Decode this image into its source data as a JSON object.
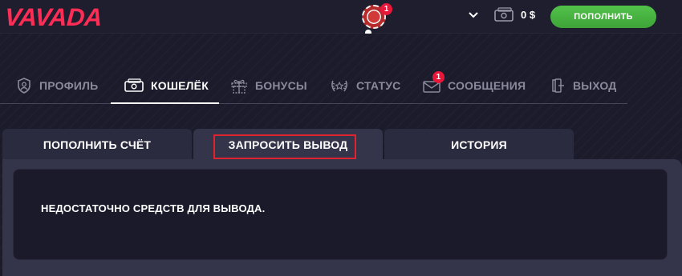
{
  "header": {
    "logo": "VAVADA",
    "avatar_badge": "1",
    "balance": "0 $",
    "deposit_label": "ПОПОЛНИТЬ",
    "icons": [
      "user-avatar-icon",
      "chevron-down-icon",
      "wallet-icon"
    ],
    "accent_color": "#ff2d55",
    "deposit_color": "#4cb845"
  },
  "nav": {
    "items": [
      {
        "label": "ПРОФИЛЬ",
        "icon": "shield-user-icon",
        "active": false
      },
      {
        "label": "КОШЕЛЁК",
        "icon": "wallet-icon",
        "active": true
      },
      {
        "label": "БОНУСЫ",
        "icon": "gift-icon",
        "active": false
      },
      {
        "label": "СТАТУС",
        "icon": "laurel-icon",
        "active": false
      },
      {
        "label": "СООБЩЕНИЯ",
        "icon": "envelope-icon",
        "active": false,
        "badge": "1"
      },
      {
        "label": "ВЫХОД",
        "icon": "logout-icon",
        "active": false
      }
    ]
  },
  "tabs": [
    {
      "label": "ПОПОЛНИТЬ СЧЁТ",
      "active": false
    },
    {
      "label": "ЗАПРОСИТЬ ВЫВОД",
      "active": true
    },
    {
      "label": "ИСТОРИЯ",
      "active": false
    }
  ],
  "panel": {
    "message": "НЕДОСТАТОЧНО СРЕДСТВ ДЛЯ ВЫВОДА."
  }
}
